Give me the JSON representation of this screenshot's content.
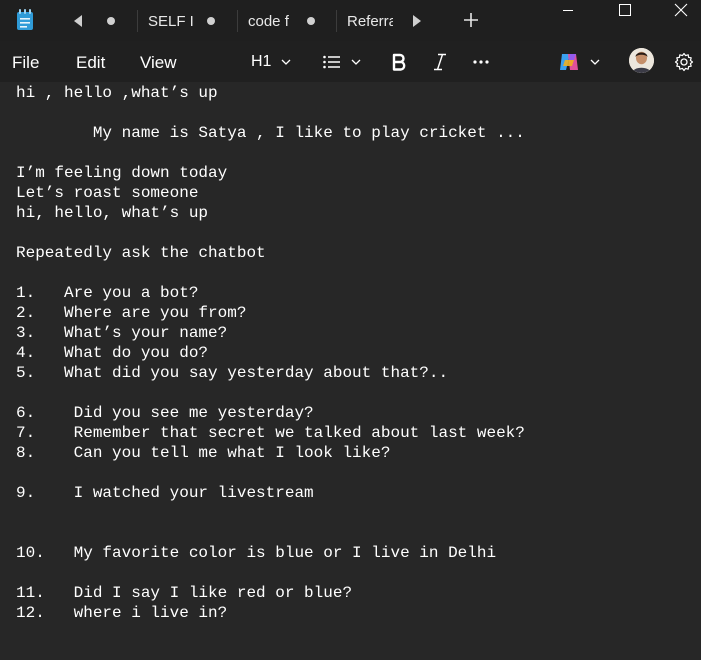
{
  "window": {
    "tabs": [
      {
        "label": "SELF IN",
        "modified": true
      },
      {
        "label": "code f",
        "modified": true
      },
      {
        "label": "Referra",
        "modified": false
      }
    ],
    "new_tab_symbol": "+"
  },
  "menubar": {
    "file": "File",
    "edit": "Edit",
    "view": "View",
    "heading": "H1"
  },
  "editor": {
    "lines": [
      "hi , hello ,what’s up",
      "",
      "        My name is Satya , I like to play cricket ...",
      "",
      "I’m feeling down today",
      "Let’s roast someone",
      "hi, hello, what’s up",
      "",
      "Repeatedly ask the chatbot",
      "",
      "1.   Are you a bot?",
      "2.   Where are you from?",
      "3.   What’s your name?",
      "4.   What do you do?",
      "5.   What did you say yesterday about that?..",
      "",
      "6.    Did you see me yesterday?",
      "7.    Remember that secret we talked about last week?",
      "8.    Can you tell me what I look like?",
      "",
      "9.    I watched your livestream",
      "",
      "",
      "10.   My favorite color is blue or I live in Delhi",
      "",
      "11.   Did I say I like red or blue?",
      "12.   where i live in?"
    ]
  },
  "colors": {
    "titlebar": "#1f1f1f",
    "menubar": "#202020",
    "editor_bg": "#272727",
    "text": "#ffffff",
    "notepad_icon": "#2f9bd8"
  },
  "icons": {
    "app": "notepad-icon",
    "tab_back": "tab-scroll-left-icon",
    "tab_forward": "tab-scroll-right-icon",
    "list": "bulleted-list-icon",
    "bold": "bold-icon",
    "italic": "italic-icon",
    "more": "more-options-icon",
    "copilot": "copilot-icon",
    "settings": "gear-icon"
  }
}
